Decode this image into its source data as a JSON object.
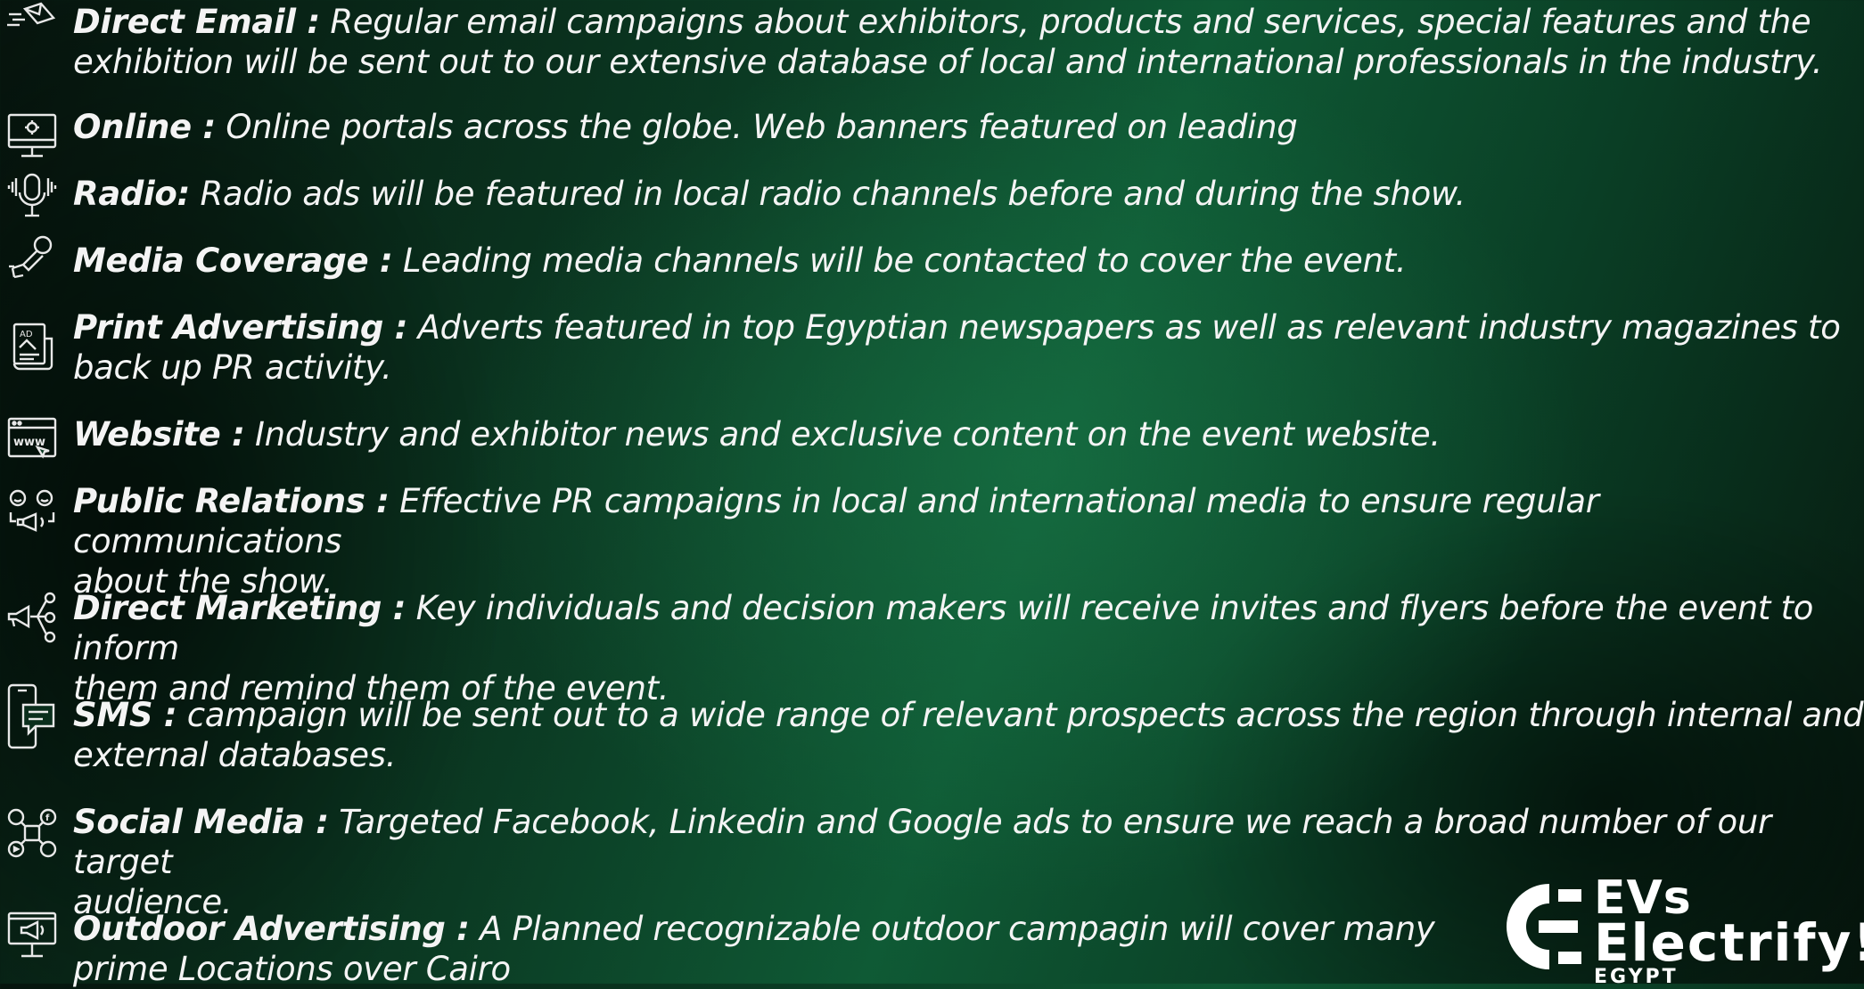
{
  "items": [
    {
      "label": "Direct Email :",
      "text": " Regular email campaigns about exhibitors, products and services, special features and the",
      "text2": "exhibition will be sent out to our extensive database of local and international professionals in the industry.",
      "icon": "envelope-send-icon"
    },
    {
      "label": "Online :",
      "text": " Online portals across the globe. Web banners featured on leading",
      "icon": "monitor-icon"
    },
    {
      "label": "Radio:",
      "text": " Radio ads will be featured in local radio channels before and during the show.",
      "icon": "microphone-icon"
    },
    {
      "label": "Media Coverage :",
      "text": " Leading media channels will be contacted to cover the event.",
      "icon": "handheld-microphone-icon"
    },
    {
      "label": "Print Advertising :",
      "text": " Adverts featured in top Egyptian newspapers as well as relevant industry magazines to",
      "text2": "back up PR activity.",
      "icon": "print-ad-icon"
    },
    {
      "label": "Website :",
      "text": " Industry and exhibitor news and exclusive content on the event website.",
      "icon": "www-browser-icon"
    },
    {
      "label": "Public Relations :",
      "text": " Effective PR campaigns in local and international media to ensure regular communications",
      "text2": "about the show.",
      "icon": "people-megaphone-icon"
    },
    {
      "label": "Direct Marketing :",
      "text": " Key individuals and decision makers will receive invites and flyers before the event to inform",
      "text2": "them and remind them of the event.",
      "icon": "megaphone-network-icon"
    },
    {
      "label": "SMS :",
      "text": " campaign will be sent out to a wide range of relevant prospects across the region through internal and",
      "text2": "external databases.",
      "icon": "phone-message-icon"
    },
    {
      "label": "Social Media :",
      "text": " Targeted Facebook, Linkedin and Google ads to ensure we reach a broad number of our target",
      "text2": "audience.",
      "icon": "social-network-icon"
    },
    {
      "label": "Outdoor Advertising :",
      "text": " A Planned recognizable outdoor campagin will cover many",
      "text2": "prime Locations over Cairo",
      "icon": "billboard-megaphone-icon"
    }
  ],
  "logo": {
    "line1": "EVs",
    "line2": "Electrify!",
    "line3": "EGYPT"
  },
  "colors": {
    "text": "#f4f4f4",
    "background_dark": "#06140d",
    "background_light": "#0f5a35"
  }
}
